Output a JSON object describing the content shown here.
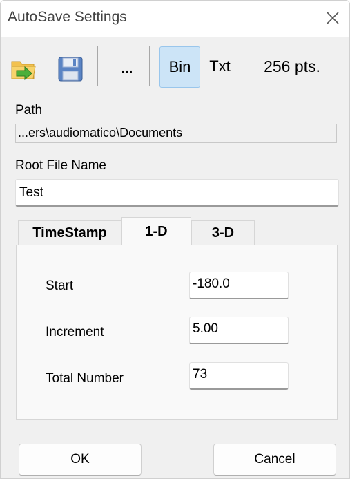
{
  "window": {
    "title": "AutoSave Settings"
  },
  "toolbar": {
    "open_icon": "folder-arrow-icon",
    "save_icon": "floppy-disk-icon",
    "browse_label": "...",
    "bin_label": "Bin",
    "txt_label": "Txt",
    "points_label": "256 pts.",
    "bin_selected": true
  },
  "path": {
    "label": "Path",
    "value": "...ers\\audiomatico\\Documents"
  },
  "root": {
    "label": "Root File Name",
    "value": "Test"
  },
  "tabs": [
    {
      "label": "TimeStamp",
      "active": false
    },
    {
      "label": "1-D",
      "active": true
    },
    {
      "label": "3-D",
      "active": false
    }
  ],
  "panel": {
    "start_label": "Start",
    "start_value": "-180.0",
    "increment_label": "Increment",
    "increment_value": "5.00",
    "total_label": "Total Number",
    "total_value": "73"
  },
  "buttons": {
    "ok_label": "OK",
    "cancel_label": "Cancel"
  },
  "colors": {
    "accent_selected": "#cce4f7",
    "folder_yellow": "#f2c14e",
    "arrow_green": "#4caf3a",
    "floppy_blue": "#5b84c4"
  }
}
